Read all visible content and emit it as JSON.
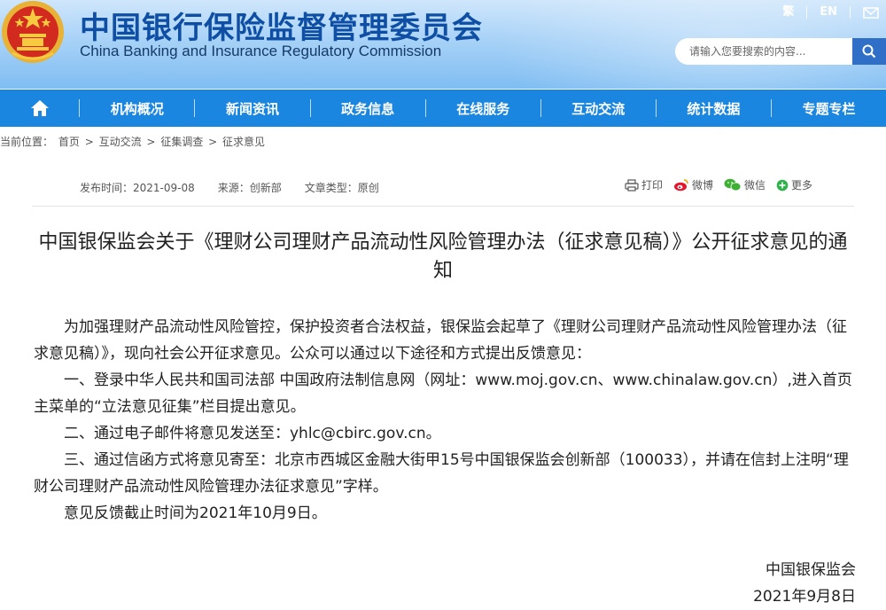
{
  "header": {
    "title_cn": "中国银行保险监督管理委员会",
    "title_en": "China Banking and Insurance Regulatory Commission",
    "links": [
      "繁",
      "EN"
    ],
    "search_placeholder": "请输入您要搜索的内容..."
  },
  "nav": {
    "items": [
      "机构概况",
      "新闻资讯",
      "政务信息",
      "在线服务",
      "互动交流",
      "统计数据",
      "专题专栏"
    ]
  },
  "breadcrumb": {
    "label": "当前位置：",
    "items": [
      "首页",
      "互动交流",
      "征集调查",
      "征求意见"
    ],
    "separator": ">"
  },
  "meta": {
    "date": "发布时间：2021-09-08",
    "source": "来源：创新部",
    "type": "文章类型：原创"
  },
  "share": {
    "print": "打印",
    "weibo": "微博",
    "wechat": "微信",
    "more": "更多"
  },
  "article": {
    "title": "中国银保监会关于《理财公司理财产品流动性风险管理办法（征求意见稿）》公开征求意见的通知",
    "paragraphs": [
      "为加强理财产品流动性风险管控，保护投资者合法权益，银保监会起草了《理财公司理财产品流动性风险管理办法（征求意见稿）》，现向社会公开征求意见。公众可以通过以下途径和方式提出反馈意见：",
      "一、登录中华人民共和国司法部 中国政府法制信息网（网址：www.moj.gov.cn、www.chinalaw.gov.cn）,进入首页主菜单的“立法意见征集”栏目提出意见。",
      "二、通过电子邮件将意见发送至：yhlc@cbirc.gov.cn。",
      "三、通过信函方式将意见寄至：北京市西城区金融大街甲15号中国银保监会创新部（100033），并请在信封上注明“理财公司理财产品流动性风险管理办法征求意见”字样。",
      "意见反馈截止时间为2021年10月9日。"
    ],
    "signature": "中国银保监会",
    "sign_date": "2021年9月8日"
  },
  "colors": {
    "nav_bg": "#1b86e0",
    "title_blue": "#0e4fa5",
    "search_button": "#2f6fc7"
  }
}
